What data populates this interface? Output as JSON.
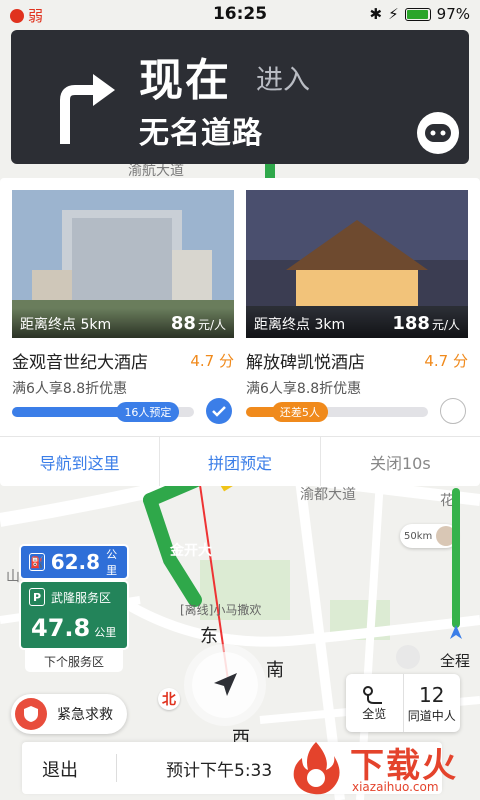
{
  "status_bar": {
    "signal_label": "弱",
    "time": "16:25",
    "battery": "97%",
    "battery_level": 0.97
  },
  "nav": {
    "now": "现在",
    "action": "进入",
    "road": "无名道路",
    "turn_icon": "turn-right-arrow-icon"
  },
  "map": {
    "labels": {
      "top_road": "渝航大道",
      "road_2": "渝都大道",
      "cn_hua": "花",
      "cn_jinkai": "金开大",
      "east": "东",
      "south": "南",
      "west": "西",
      "shan": "山"
    },
    "offline_label": "[离线]小马撒欢",
    "avatar_distance": "50km",
    "north_badge": "北"
  },
  "hotels": [
    {
      "distance": "距离终点 5km",
      "price": "88",
      "price_unit": "元/人",
      "name": "金观音世纪大酒店",
      "score": "4.7 分",
      "promo": "满6人享8.8折优惠",
      "progress_label": "16人预定",
      "progress": 0.92,
      "bar_color": "#3b7ee8",
      "selected": true
    },
    {
      "distance": "距离终点 3km",
      "price": "188",
      "price_unit": "元/人",
      "name": "解放碑凯悦酒店",
      "score": "4.7 分",
      "promo": "满6人享8.8折优惠",
      "progress_label": "还差5人",
      "progress": 0.45,
      "bar_color": "#f08a1c",
      "selected": false
    }
  ],
  "actions": {
    "navigate": "导航到这里",
    "group_book": "拼团预定",
    "close": "关闭10s"
  },
  "service_area": {
    "distance_1": "62.8",
    "unit_1": "公里",
    "name": "武隆服务区",
    "distance_2": "47.8",
    "unit_2": "公里",
    "caption": "下个服务区"
  },
  "emergency": "紧急求救",
  "overview": {
    "label": "全览",
    "count": "12",
    "count_label": "同道中人"
  },
  "route_label": "全程",
  "bottom": {
    "exit": "退出",
    "eta": "预计下午5:33"
  },
  "watermark": {
    "title": "下载火",
    "url": "xiazaihuo.com"
  },
  "colors": {
    "accent": "#3b7ee8",
    "nav_bg": "#2c2e34",
    "route_green": "#36b24b",
    "warning": "#f08a1c",
    "danger": "#e84d3c"
  }
}
